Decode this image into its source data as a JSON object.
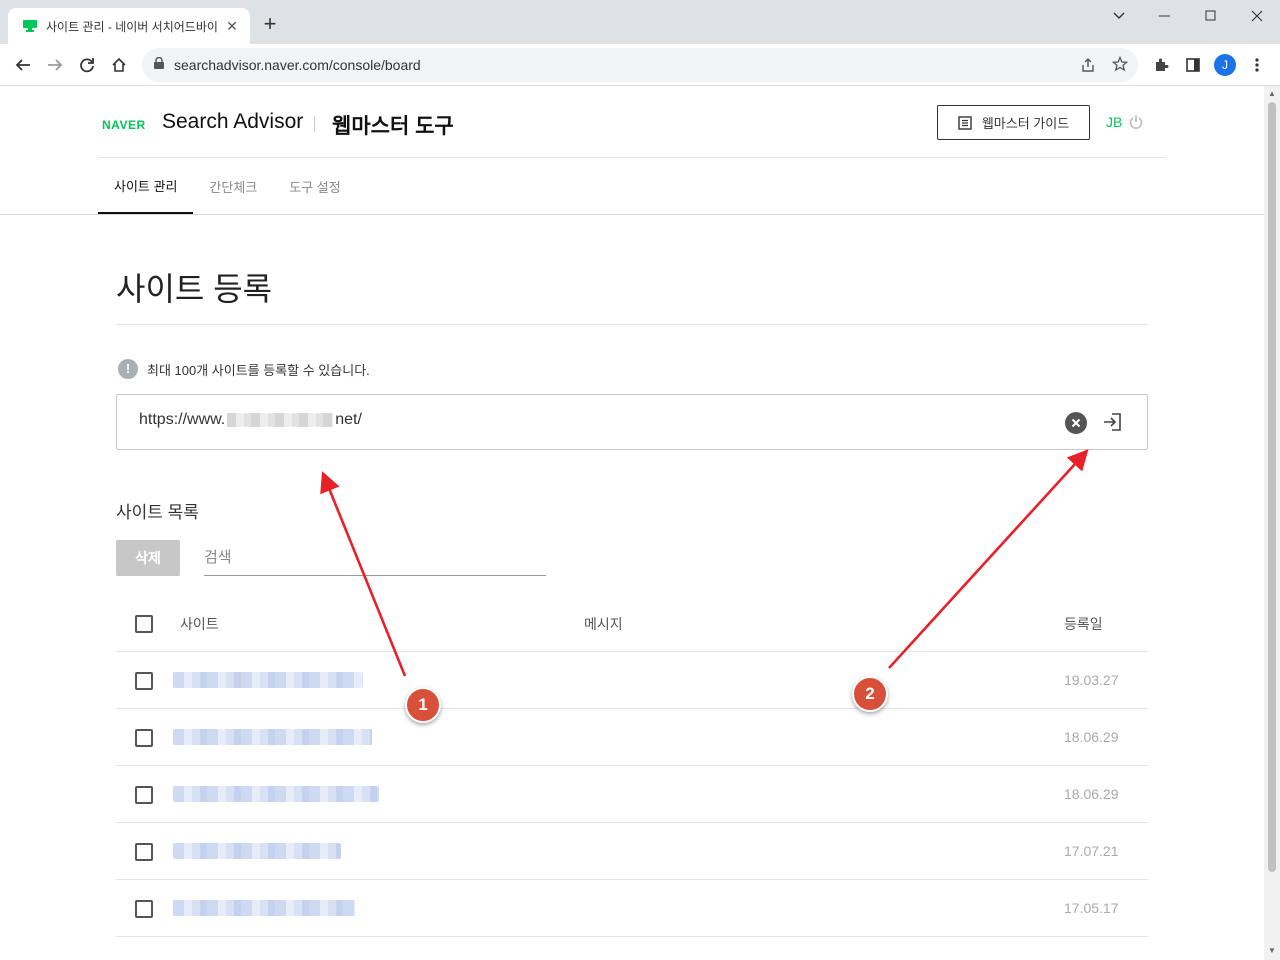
{
  "browser": {
    "tab_title": "사이트 관리 - 네이버 서치어드바이저",
    "url": "searchadvisor.naver.com/console/board"
  },
  "profile_initial": "J",
  "header": {
    "naver_logo": "NAVER",
    "brand": "Search Advisor",
    "sub": "웹마스터 도구",
    "guide_button": "웹마스터 가이드",
    "user": "JB"
  },
  "nav": {
    "items": [
      "사이트 관리",
      "간단체크",
      "도구 설정"
    ]
  },
  "page": {
    "title": "사이트 등록",
    "notice": "최대 100개 사이트를 등록할 수 있습니다.",
    "url_prefix": "https://www.",
    "url_suffix": "net/"
  },
  "list": {
    "title": "사이트 목록",
    "delete_label": "삭제",
    "search_placeholder": "검색",
    "columns": {
      "site": "사이트",
      "message": "메시지",
      "date": "등록일"
    },
    "rows": [
      {
        "date": "19.03.27",
        "blur": 0.79
      },
      {
        "date": "18.06.29",
        "blur": 0.83
      },
      {
        "date": "18.06.29",
        "blur": 0.86
      },
      {
        "date": "17.07.21",
        "blur": 0.7
      },
      {
        "date": "17.05.17",
        "blur": 0.76
      }
    ]
  },
  "annotations": [
    "1",
    "2"
  ],
  "colors": {
    "naver_green": "#03c75a",
    "annotation_red": "#e8202a",
    "badge": "#d9503a"
  }
}
